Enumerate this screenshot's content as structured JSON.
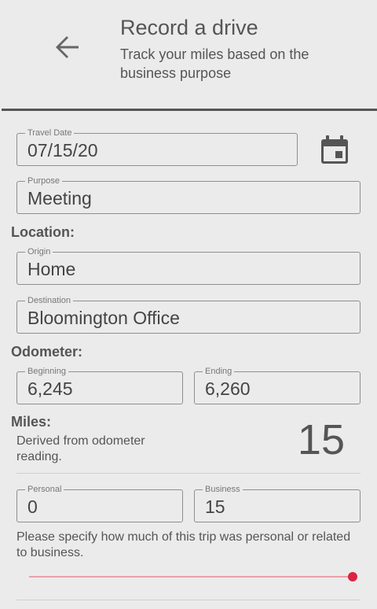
{
  "header": {
    "title": "Record a drive",
    "subtitle": "Track your miles based on the business purpose"
  },
  "icons": {
    "back": "arrow-left-icon",
    "calendar": "calendar-icon"
  },
  "fields": {
    "travel_date": {
      "label": "Travel Date",
      "value": "07/15/20"
    },
    "purpose": {
      "label": "Purpose",
      "value": "Meeting"
    },
    "origin": {
      "label": "Origin",
      "value": "Home"
    },
    "destination": {
      "label": "Destination",
      "value": "Bloomington Office"
    },
    "beginning": {
      "label": "Beginning",
      "value": "6,245"
    },
    "ending": {
      "label": "Ending",
      "value": "6,260"
    },
    "personal": {
      "label": "Personal",
      "value": "0"
    },
    "business": {
      "label": "Business",
      "value": "15"
    }
  },
  "sections": {
    "location": "Location:",
    "odometer": "Odometer:",
    "miles": "Miles:"
  },
  "miles": {
    "help": "Derived from odometer reading.",
    "value": "15"
  },
  "split_help": "Please specify how much of this trip was personal or related to business.",
  "slider": {
    "business_fraction": 1.0,
    "accent": "#dc2342"
  }
}
